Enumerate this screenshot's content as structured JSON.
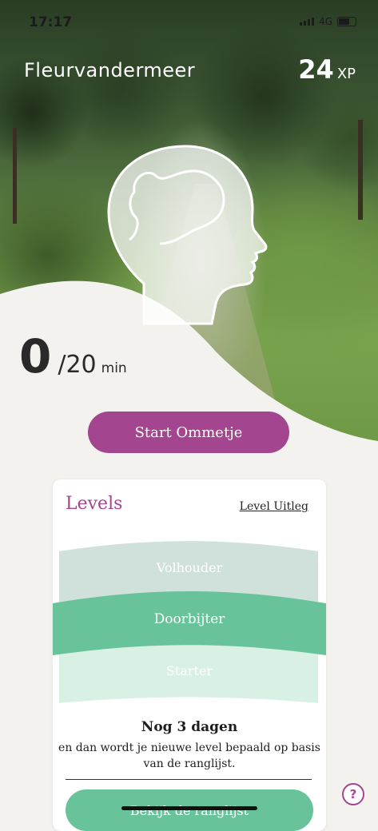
{
  "status_bar": {
    "time": "17:17",
    "network": "4G"
  },
  "header": {
    "username": "Fleurvandermeer",
    "xp_value": "24",
    "xp_unit": "XP"
  },
  "progress": {
    "current": "0",
    "total": "/20",
    "unit": "min",
    "fraction": 0
  },
  "start_button": {
    "label": "Start Ommetje"
  },
  "levels_card": {
    "title": "Levels",
    "info_link": "Level Uitleg",
    "levels": [
      {
        "label": "Volhouder",
        "color": "#cfe1da"
      },
      {
        "label": "Doorbijter",
        "color": "#68c39a"
      },
      {
        "label": "Starter",
        "color": "#d9f0e5"
      }
    ],
    "countdown_title": "Nog 3 dagen",
    "countdown_text": "en dan wordt je nieuwe level bepaald op basis van de ranglijst.",
    "ranking_button": "Bekijk de ranglijst"
  },
  "help": {
    "symbol": "?"
  },
  "colors": {
    "accent": "#a3458f",
    "green": "#68c39a",
    "background": "#f3f2ee"
  }
}
